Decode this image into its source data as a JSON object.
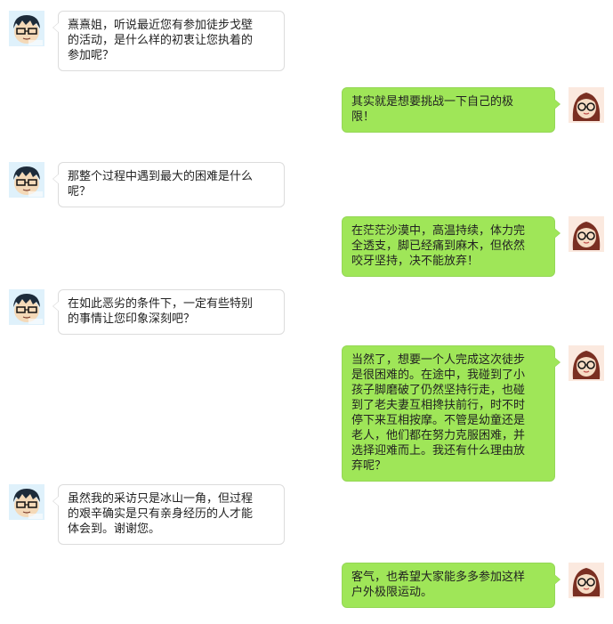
{
  "messages": [
    {
      "side": "left",
      "avatar": "boy-avatar-icon",
      "text": "熹熹姐，听说最近您有参加徒步戈壁\n的活动，是什么样的初衷让您执着的\n参加呢？"
    },
    {
      "side": "right",
      "avatar": "girl-avatar-icon",
      "text": "其实就是想要挑战一下自己的极\n限！"
    },
    {
      "side": "left",
      "avatar": "boy-avatar-icon",
      "text": "那整个过程中遇到最大的困难是什么\n呢？"
    },
    {
      "side": "right",
      "avatar": "girl-avatar-icon",
      "text": "在茫茫沙漠中，高温持续，体力完\n全透支，脚已经痛到麻木，但依然\n咬牙坚持，决不能放弃！"
    },
    {
      "side": "left",
      "avatar": "boy-avatar-icon",
      "text": "在如此恶劣的条件下，一定有些特别\n的事情让您印象深刻吧？"
    },
    {
      "side": "right",
      "avatar": "girl-avatar-icon",
      "text": "当然了，想要一个人完成这次徒步\n是很困难的。在途中，我碰到了小\n孩子脚磨破了仍然坚持行走，也碰\n到了老夫妻互相搀扶前行，时不时\n停下来互相按摩。不管是幼童还是\n老人，他们都在努力克服困难，并\n选择迎难而上。我还有什么理由放\n弃呢？"
    },
    {
      "side": "left",
      "avatar": "boy-avatar-icon",
      "text": "虽然我的采访只是冰山一角，但过程\n的艰辛确实是只有亲身经历的人才能\n体会到。谢谢您。"
    },
    {
      "side": "right",
      "avatar": "girl-avatar-icon",
      "text": "客气，也希望大家能多多参加这样\n户外极限运动。"
    }
  ]
}
